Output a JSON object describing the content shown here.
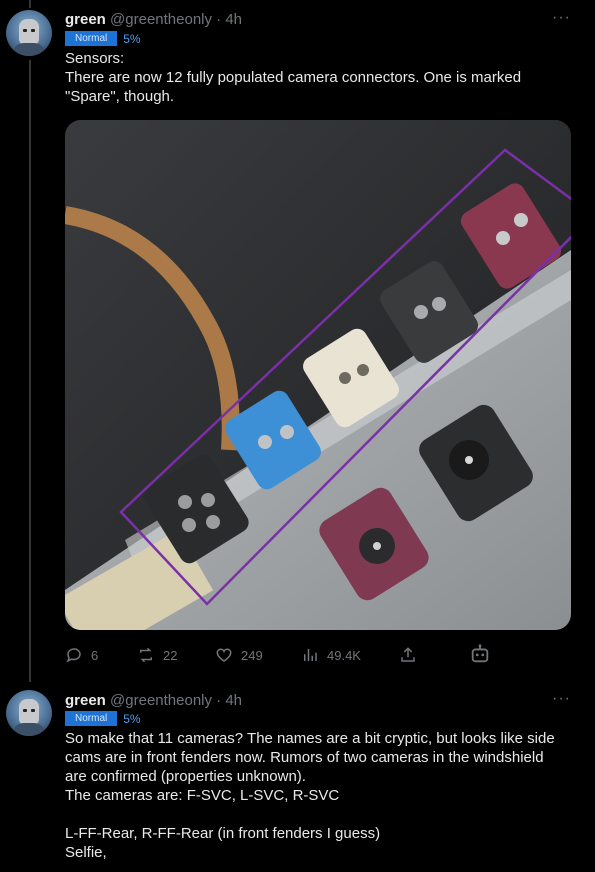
{
  "tweet1": {
    "name": "green",
    "handle": "@greentheonly",
    "separator": "·",
    "time": "4h",
    "badge": "Normal",
    "percent": "5%",
    "lines": [
      "Sensors:",
      "There are now 12 fully populated camera connectors. One is marked",
      "\"Spare\", though."
    ],
    "image_alt": "photo of camera connectors",
    "actions": {
      "reply_count": "6",
      "retweet_count": "22",
      "like_count": "249",
      "view_count": "49.4K"
    }
  },
  "tweet2": {
    "name": "green",
    "handle": "@greentheonly",
    "separator": "·",
    "time": "4h",
    "badge": "Normal",
    "percent": "5%",
    "lines": [
      "So make that 11 cameras? The names are a bit cryptic, but looks like side",
      "cams are in front fenders now. Rumors of two cameras in the windshield",
      "are confirmed (properties unknown).",
      "The cameras are: F-SVC, L-SVC, R-SVC",
      "",
      "L-FF-Rear, R-FF-Rear (in front fenders I guess)",
      "Selfie,"
    ]
  },
  "more_label": "···",
  "colors": {
    "background": "#000000",
    "text": "#e7e9ea",
    "muted": "#71767b",
    "badge": "#1d74d6",
    "highlight": "#7b2fa8"
  },
  "icons": [
    "reply-icon",
    "retweet-icon",
    "like-icon",
    "views-icon",
    "share-icon",
    "grok-bot-icon",
    "more-icon"
  ]
}
